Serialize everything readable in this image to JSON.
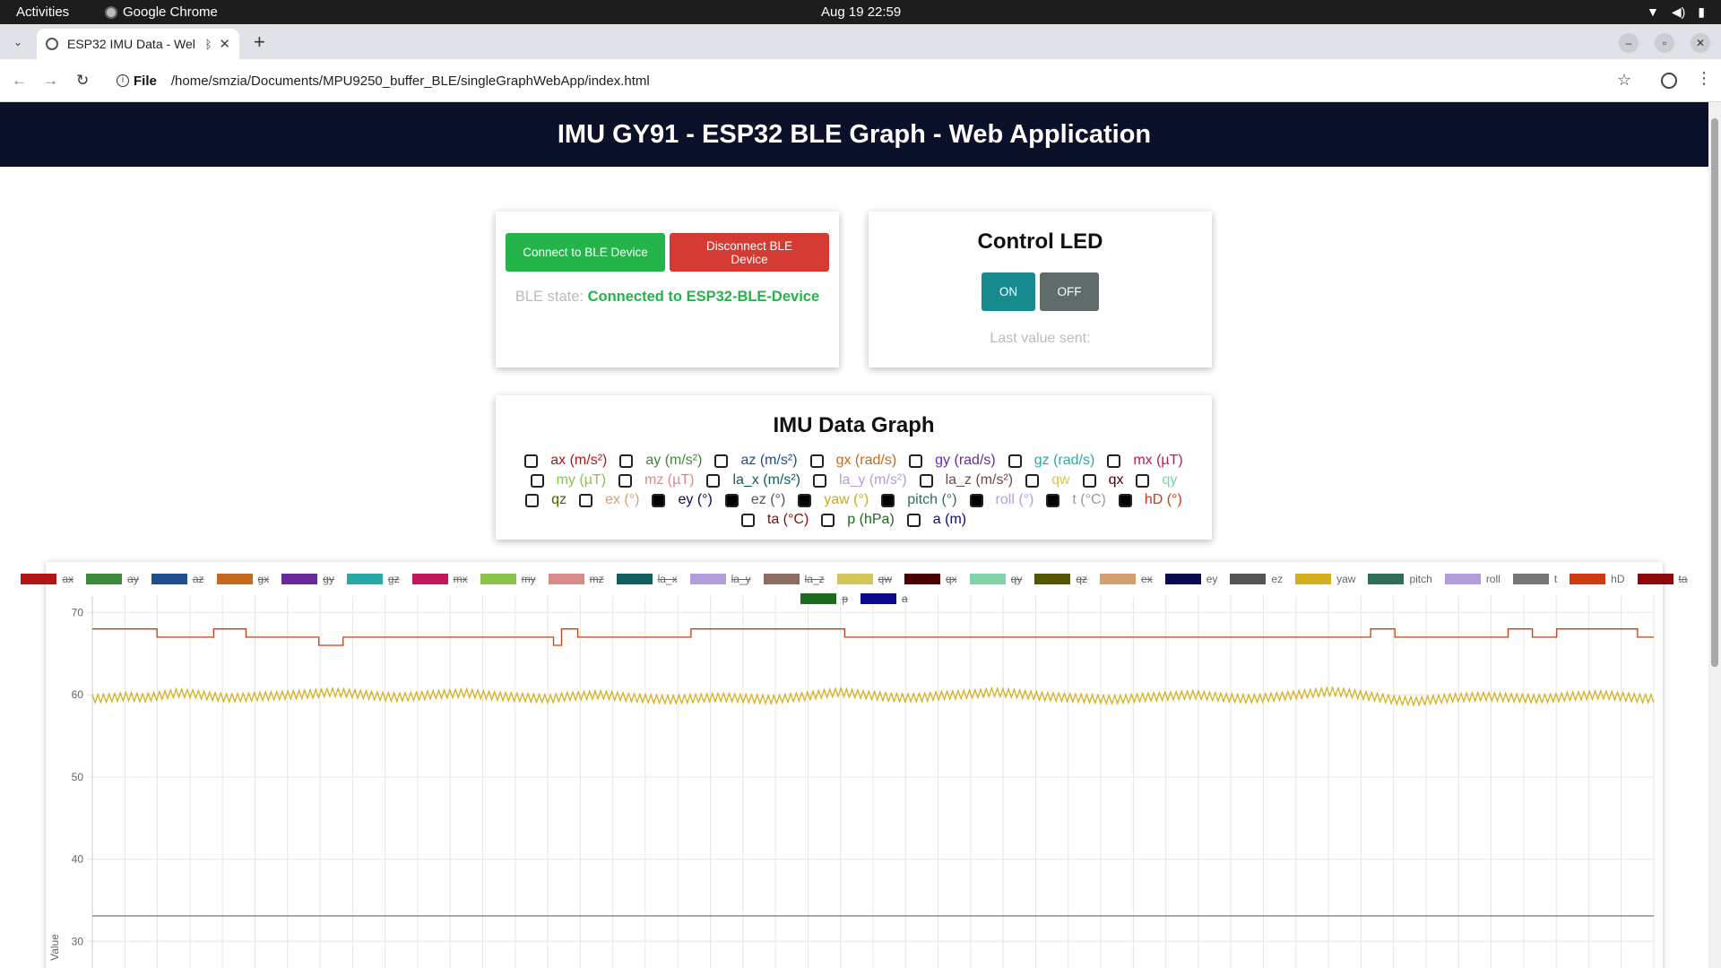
{
  "os": {
    "activities": "Activities",
    "app": "Google Chrome",
    "clock": "Aug 19  22:59"
  },
  "browser": {
    "tab_title": "ESP32 IMU Data - Wel",
    "scheme": "File",
    "url": "/home/smzia/Documents/MPU9250_buffer_BLE/singleGraphWebApp/index.html"
  },
  "header": {
    "title": "IMU GY91 - ESP32 BLE Graph - Web Application"
  },
  "ble": {
    "connect_label": "Connect to BLE Device",
    "disconnect_label": "Disconnect BLE Device",
    "state_label": "BLE state: ",
    "state_value": "Connected to ESP32-BLE-Device"
  },
  "led": {
    "title": "Control LED",
    "on_label": "ON",
    "off_label": "OFF",
    "last_label": "Last value sent:"
  },
  "graph": {
    "title": "IMU Data Graph",
    "checkbox_rows": [
      [
        {
          "label": "ax (m/s²)",
          "color": "#b31515",
          "checked": false
        },
        {
          "label": "ay (m/s²)",
          "color": "#3a8a3a",
          "checked": false
        },
        {
          "label": "az (m/s²)",
          "color": "#1f4e8c",
          "checked": false
        },
        {
          "label": "gx (rad/s)",
          "color": "#c46a1f",
          "checked": false
        },
        {
          "label": "gy (rad/s)",
          "color": "#6a2a9c",
          "checked": false
        },
        {
          "label": "gz (rad/s)",
          "color": "#2aa8a8",
          "checked": false
        },
        {
          "label": "mx (µT)",
          "color": "#c2185b",
          "checked": false
        }
      ],
      [
        {
          "label": "my (µT)",
          "color": "#8bc34a",
          "checked": false
        },
        {
          "label": "mz (µT)",
          "color": "#d98c8c",
          "checked": false
        },
        {
          "label": "la_x (m/s²)",
          "color": "#0f5f5f",
          "checked": false
        },
        {
          "label": "la_y (m/s²)",
          "color": "#b39ddb",
          "checked": false
        },
        {
          "label": "la_z (m/s²)",
          "color": "#6d4c41",
          "checked": false
        },
        {
          "label": "qw",
          "color": "#d4c75a",
          "checked": false
        },
        {
          "label": "qx",
          "color": "#4a0000",
          "checked": false
        },
        {
          "label": "qy",
          "color": "#80d4a8",
          "checked": false
        }
      ],
      [
        {
          "label": "qz",
          "color": "#555500",
          "checked": false
        },
        {
          "label": "ex (°)",
          "color": "#d4a070",
          "checked": false
        },
        {
          "label": "ey (°)",
          "color": "#0a0a50",
          "checked": true
        },
        {
          "label": "ez (°)",
          "color": "#555555",
          "checked": true
        },
        {
          "label": "yaw (°)",
          "color": "#c9a820",
          "checked": true
        },
        {
          "label": "pitch (°)",
          "color": "#2e6e5a",
          "checked": true
        },
        {
          "label": "roll (°)",
          "color": "#b39ddb",
          "checked": true
        },
        {
          "label": "t (°C)",
          "color": "#999999",
          "checked": true
        },
        {
          "label": "hD (°)",
          "color": "#d03a10",
          "checked": true
        }
      ],
      [
        {
          "label": "ta (°C)",
          "color": "#8b0a0a",
          "checked": false
        },
        {
          "label": "p (hPa)",
          "color": "#1a6b1a",
          "checked": false
        },
        {
          "label": "a (m)",
          "color": "#0a0a8a",
          "checked": false
        }
      ]
    ]
  },
  "chart_data": {
    "type": "line",
    "ylabel": "Value",
    "y_ticks": [
      30,
      40,
      50,
      60,
      70
    ],
    "ylim": [
      26,
      72
    ],
    "grid": true,
    "legend_position": "top",
    "legend_rows": [
      [
        {
          "name": "ax",
          "color": "#b31515",
          "hidden": true
        },
        {
          "name": "ay",
          "color": "#3a8a3a",
          "hidden": true
        },
        {
          "name": "az",
          "color": "#1f4e8c",
          "hidden": true
        },
        {
          "name": "gx",
          "color": "#c46a1f",
          "hidden": true
        },
        {
          "name": "gy",
          "color": "#6a2a9c",
          "hidden": true
        },
        {
          "name": "gz",
          "color": "#2aa8a8",
          "hidden": true
        },
        {
          "name": "mx",
          "color": "#c2185b",
          "hidden": true
        },
        {
          "name": "my",
          "color": "#8bc34a",
          "hidden": true
        },
        {
          "name": "mz",
          "color": "#d98c8c",
          "hidden": true
        },
        {
          "name": "la_x",
          "color": "#0f5f5f",
          "hidden": true
        },
        {
          "name": "la_y",
          "color": "#b39ddb",
          "hidden": true
        },
        {
          "name": "la_z",
          "color": "#8d6e63",
          "hidden": true
        },
        {
          "name": "qw",
          "color": "#d4c75a",
          "hidden": true
        },
        {
          "name": "qx",
          "color": "#4a0000",
          "hidden": true
        },
        {
          "name": "qy",
          "color": "#80d4a8",
          "hidden": true
        },
        {
          "name": "qz",
          "color": "#555500",
          "hidden": true
        },
        {
          "name": "ex",
          "color": "#d4a070",
          "hidden": true
        },
        {
          "name": "ey",
          "color": "#0a0a50",
          "hidden": false
        },
        {
          "name": "ez",
          "color": "#555555",
          "hidden": false
        },
        {
          "name": "yaw",
          "color": "#d4b020",
          "hidden": false
        },
        {
          "name": "pitch",
          "color": "#2e6e5a",
          "hidden": false
        },
        {
          "name": "roll",
          "color": "#b39ddb",
          "hidden": false
        },
        {
          "name": "t",
          "color": "#777777",
          "hidden": false
        },
        {
          "name": "hD",
          "color": "#d03a10",
          "hidden": false
        },
        {
          "name": "ta",
          "color": "#8b0a0a",
          "hidden": true
        }
      ],
      [
        {
          "name": "p",
          "color": "#1a6b1a",
          "hidden": true
        },
        {
          "name": "a",
          "color": "#0a0a8a",
          "hidden": true
        }
      ]
    ],
    "series": [
      {
        "name": "hD",
        "color": "#d03a10",
        "values": [
          68,
          68,
          68,
          68,
          68,
          68,
          68,
          68,
          67,
          67,
          67,
          67,
          67,
          67,
          67,
          68,
          68,
          68,
          68,
          67,
          67,
          67,
          67,
          67,
          67,
          67,
          67,
          67,
          66,
          66,
          66,
          67,
          67,
          67,
          67,
          67,
          67,
          67,
          67,
          67,
          67,
          67,
          67,
          67,
          67,
          67,
          67,
          67,
          67,
          67,
          67,
          67,
          67,
          67,
          67,
          67,
          67,
          66,
          68,
          68,
          67,
          67,
          67,
          67,
          67,
          67,
          67,
          67,
          67,
          67,
          67,
          67,
          67,
          67,
          68,
          68,
          68,
          68,
          68,
          68,
          68,
          68,
          68,
          68,
          68,
          68,
          68,
          68,
          68,
          68,
          68,
          68,
          68,
          67,
          67,
          67,
          67,
          67,
          67,
          67,
          67,
          67,
          67,
          67,
          67,
          67,
          67,
          67,
          67,
          67,
          67,
          67,
          67,
          67,
          67,
          67,
          67,
          67,
          67,
          67,
          67,
          67,
          67,
          67,
          67,
          67,
          67,
          67,
          67,
          67,
          67,
          67,
          67,
          67,
          67,
          67,
          67,
          67,
          67,
          67,
          67,
          67,
          67,
          67,
          67,
          67,
          67,
          67,
          67,
          67,
          67,
          67,
          67,
          67,
          67,
          67,
          67,
          67,
          68,
          68,
          68,
          67,
          67,
          67,
          67,
          67,
          67,
          67,
          67,
          67,
          67,
          67,
          67,
          67,
          67,
          68,
          68,
          68,
          67,
          67,
          67,
          68,
          68,
          68,
          68,
          68,
          68,
          68,
          68,
          68,
          68,
          67,
          67,
          67
        ]
      },
      {
        "name": "yaw",
        "color": "#d4b020",
        "values": [
          59.5,
          59.6,
          59.8,
          59.6,
          59.9,
          60.2,
          60.1,
          59.8,
          59.6,
          59.7,
          59.8,
          59.9,
          60.0,
          60.1,
          60.3,
          60.2,
          60.0,
          59.8,
          59.7,
          59.8,
          60.0,
          60.1,
          60.2,
          60.0,
          59.8,
          59.7,
          59.6,
          59.5,
          59.8,
          59.9,
          60.0,
          59.8,
          59.6,
          59.5,
          59.4,
          59.5,
          59.6,
          59.7,
          59.6,
          59.5,
          59.4,
          59.6,
          59.8,
          60.1,
          60.3,
          60.1,
          59.9,
          59.7,
          59.6,
          59.7,
          59.9,
          60.0,
          60.1,
          60.3,
          60.2,
          60.0,
          59.8,
          59.7,
          59.6,
          59.5,
          59.4,
          59.5,
          59.7,
          59.8,
          59.9,
          60.0,
          59.8,
          59.6,
          59.5,
          59.6,
          59.8,
          60.0,
          60.2,
          60.4,
          60.2,
          59.9,
          59.6,
          59.3,
          59.2,
          59.4,
          59.6,
          59.7,
          59.8,
          59.7,
          59.6,
          59.5,
          59.6,
          59.8,
          59.9,
          60.0,
          59.8,
          59.6,
          59.5
        ],
        "amplitude": 0.5
      },
      {
        "name": "t",
        "color": "#777777",
        "values": [
          33.1,
          33.1,
          33.1,
          33.1,
          33.1,
          33.1,
          33.1,
          33.1,
          33.1,
          33.1,
          33.1,
          33.1,
          33.1,
          33.1,
          33.1,
          33.1,
          33.1,
          33.1,
          33.1,
          33.1
        ]
      }
    ]
  }
}
